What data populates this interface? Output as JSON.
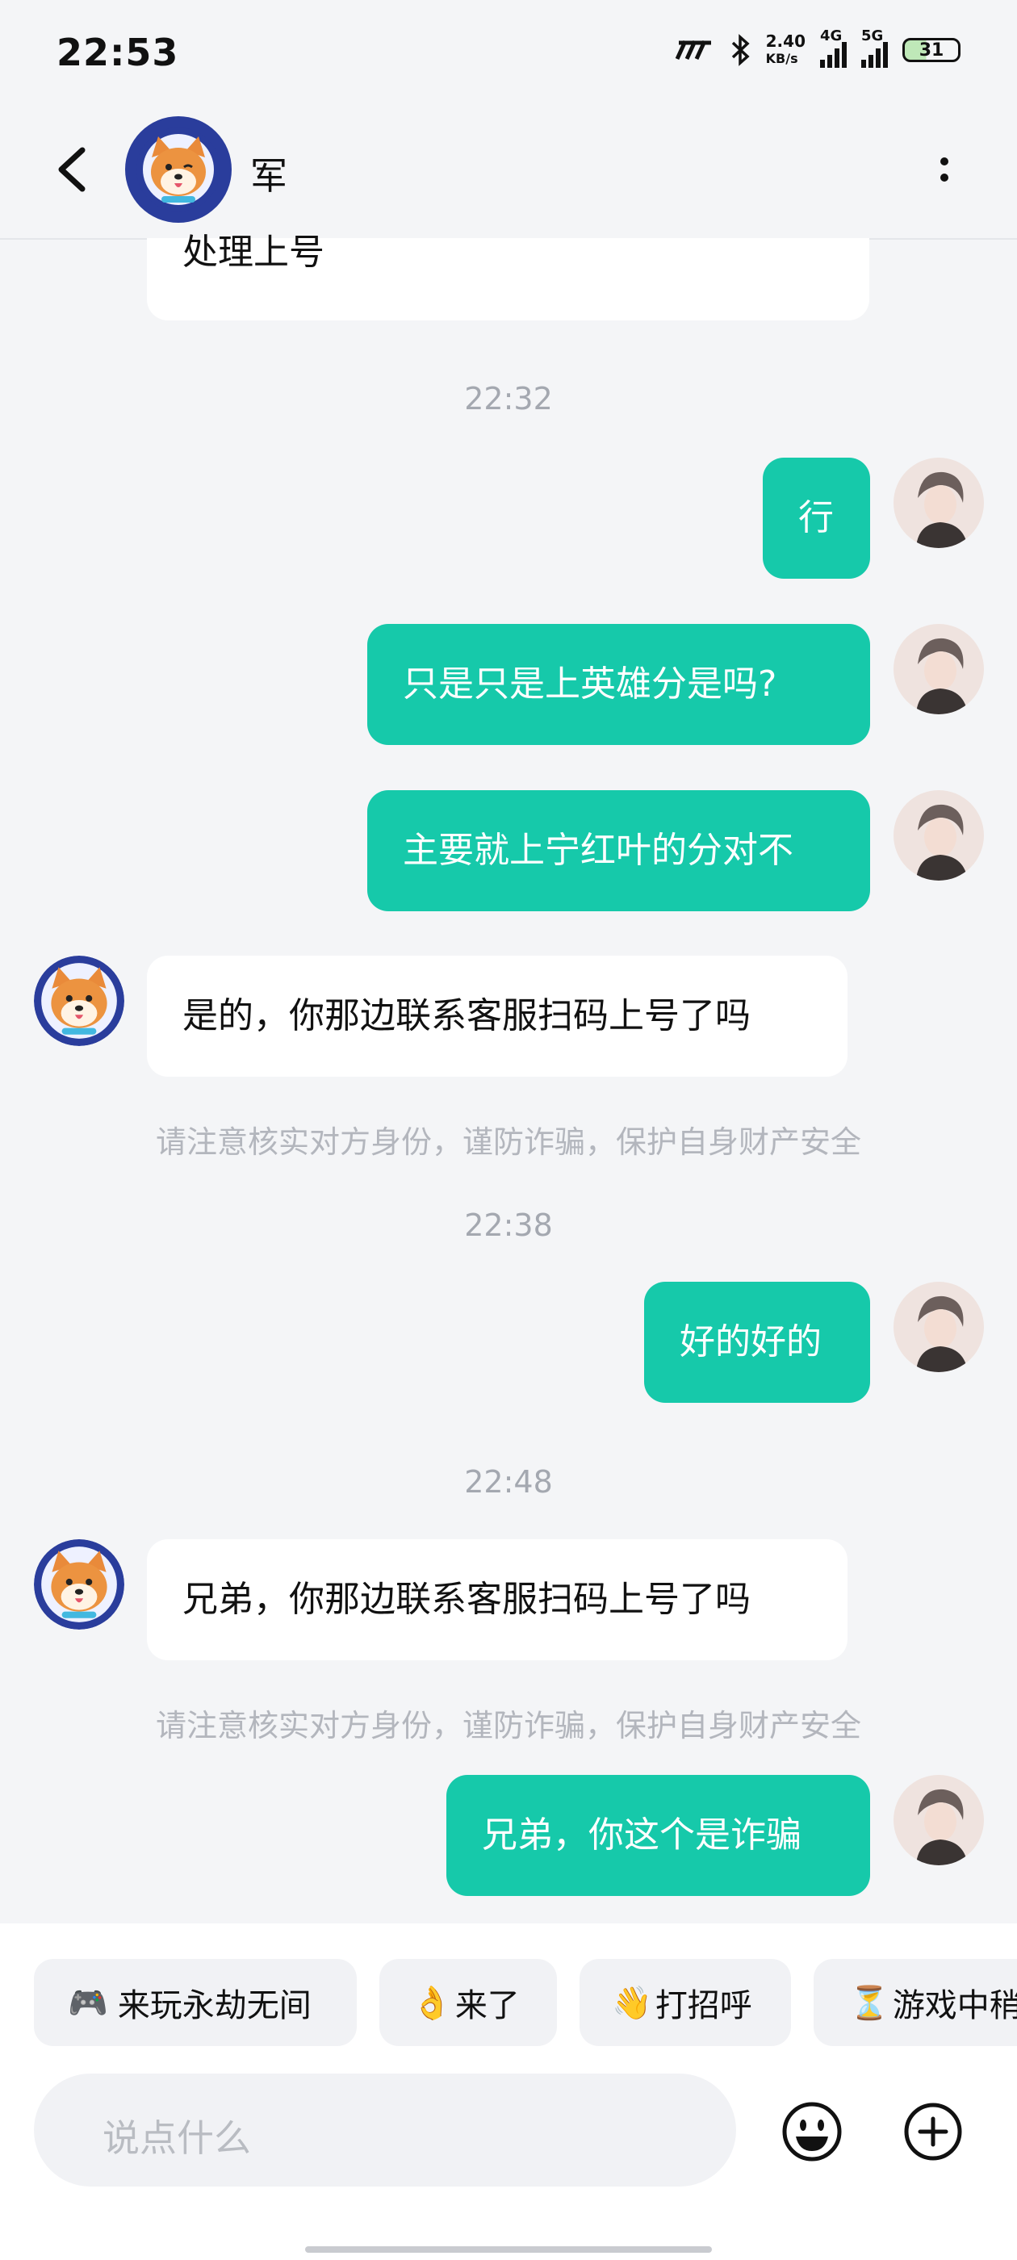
{
  "status": {
    "time": "22:53",
    "speed_value": "2.40",
    "speed_unit": "KB/s",
    "net1": "4G",
    "net2": "5G",
    "battery": "31"
  },
  "header": {
    "contact_name": "军"
  },
  "messages": {
    "m0": "处理上号",
    "t1": "22:32",
    "m1": "行",
    "m2": "只是只是上英雄分是吗?",
    "m3": "主要就上宁红叶的分对不",
    "m4": "是的，你那边联系客服扫码上号了吗",
    "n1": "请注意核实对方身份，谨防诈骗，保护自身财产安全",
    "t2": "22:38",
    "m5": "好的好的",
    "t3": "22:48",
    "m6": "兄弟，你那边联系客服扫码上号了吗",
    "n2": "请注意核实对方身份，谨防诈骗，保护自身财产安全",
    "m7": "兄弟，你这个是诈骗"
  },
  "quick_replies": [
    {
      "icon": "🎮",
      "label": "来玩永劫无间"
    },
    {
      "icon": "👌",
      "label": "来了"
    },
    {
      "icon": "👋",
      "label": "打招呼"
    },
    {
      "icon": "⏳",
      "label": "游戏中稍"
    }
  ],
  "composer": {
    "placeholder": "说点什么"
  },
  "colors": {
    "accent": "#16c9aa",
    "background": "#f4f5f7"
  }
}
